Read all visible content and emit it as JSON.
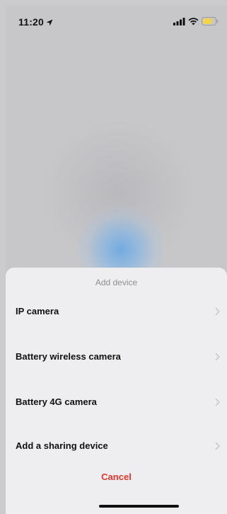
{
  "status_bar": {
    "time": "11:20",
    "location_icon": "location-arrow-icon",
    "signal_icon": "cellular-signal-icon",
    "wifi_icon": "wifi-icon",
    "battery_icon": "battery-icon",
    "battery_color": "#f2d44a"
  },
  "background": {
    "accent_color": "#6fa9e0"
  },
  "sheet": {
    "title": "Add device",
    "items": [
      {
        "label": "IP camera",
        "icon": "chevron-right-icon"
      },
      {
        "label": "Battery wireless camera",
        "icon": "chevron-right-icon"
      },
      {
        "label": "Battery 4G camera",
        "icon": "chevron-right-icon"
      },
      {
        "label": "Add a sharing device",
        "icon": "chevron-right-icon"
      }
    ],
    "cancel_label": "Cancel",
    "cancel_color": "#e5352b"
  }
}
